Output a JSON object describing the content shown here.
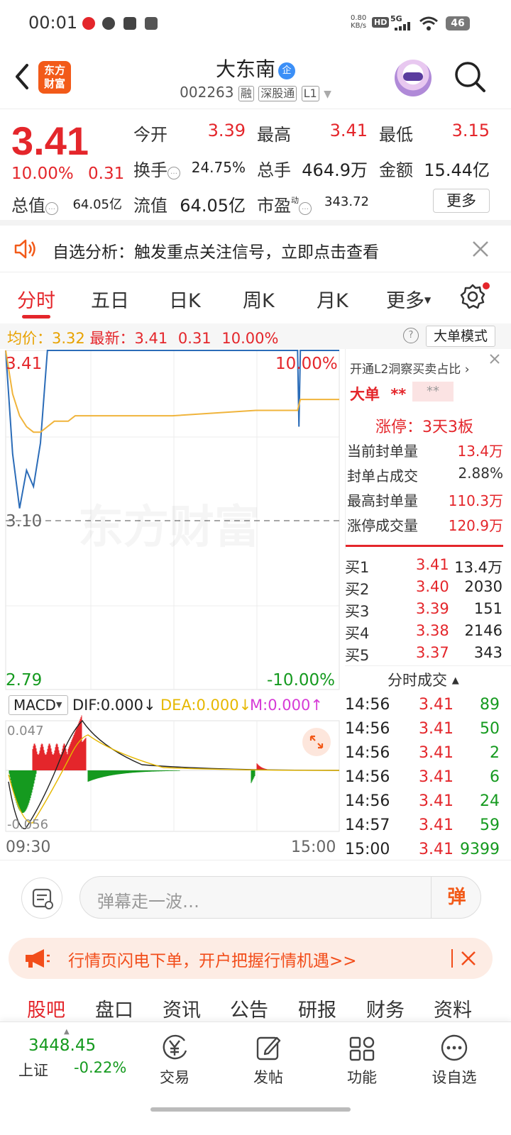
{
  "status_bar": {
    "time": "00:01",
    "net_speed_top": "0.80",
    "net_speed_bottom": "KB/s",
    "hd": "HD",
    "signal": "5G",
    "battery": "46"
  },
  "header": {
    "stock_name": "大东南",
    "qiye_badge": "企",
    "code": "002263",
    "tags": [
      "融",
      "深股通",
      "L1"
    ],
    "logo_line1": "东方",
    "logo_line2": "财富"
  },
  "quote": {
    "price": "3.41",
    "change_pct": "10.00%",
    "change": "0.31",
    "open_label": "今开",
    "open": "3.39",
    "high_label": "最高",
    "high": "3.41",
    "low_label": "最低",
    "low": "3.15",
    "turnover_label": "换手",
    "turnover": "24.75%",
    "volume_label": "总手",
    "volume": "464.9万",
    "amount_label": "金额",
    "amount": "15.44亿",
    "total_cap_label": "总值",
    "total_cap": "64.05亿",
    "float_cap_label": "流值",
    "float_cap": "64.05亿",
    "pe_label": "市盈",
    "pe_sup": "动",
    "pe": "343.72",
    "more_label": "更多"
  },
  "analysis": {
    "text": "自选分析：触发重点关注信号，立即点击查看"
  },
  "tabs": {
    "items": [
      "分时",
      "五日",
      "日K",
      "周K",
      "月K",
      "更多"
    ],
    "active": 0
  },
  "avg_line": {
    "avg_label": "均价：",
    "avg": "3.32",
    "latest_label": "最新：",
    "latest": "3.41",
    "chg": "0.31",
    "pct": "10.00%",
    "big_mode": "大单模式",
    "help": "?"
  },
  "chart": {
    "top_price": "3.41",
    "top_pct": "10.00%",
    "mid_price": "3.10",
    "bottom_price": "2.79",
    "bottom_pct": "-10.00%",
    "watermark": "东方财富",
    "time_start": "09:30",
    "time_end": "15:00",
    "macd_select": "MACD",
    "dif": "DIF:0.000",
    "dea": "DEA:0.000",
    "m": "M:0.000",
    "macd_top": "0.047",
    "macd_bottom": "-0.056",
    "colors": {
      "price": "#2b6cb8",
      "avg": "#f0b43c",
      "up": "#e4262b",
      "down": "#159a1f",
      "dea": "#e6b800",
      "m": "#d63ad6"
    }
  },
  "chart_data": {
    "type": "line",
    "title": "",
    "xlabel": "",
    "ylabel": "",
    "x": [
      "09:30",
      "09:35",
      "09:40",
      "09:45",
      "09:50",
      "09:55",
      "10:00",
      "10:05",
      "10:10",
      "10:15",
      "10:20",
      "11:30",
      "13:00",
      "14:00",
      "14:30",
      "14:31",
      "14:32",
      "15:00"
    ],
    "series": [
      {
        "values": [
          3.41,
          3.22,
          3.12,
          3.19,
          3.16,
          3.24,
          3.41,
          3.41,
          3.41,
          3.41,
          3.41,
          3.41,
          3.41,
          3.41,
          3.41,
          3.27,
          3.41,
          3.41
        ]
      },
      {
        "values": [
          3.41,
          3.33,
          3.29,
          3.27,
          3.26,
          3.26,
          3.27,
          3.28,
          3.28,
          3.28,
          3.29,
          3.29,
          3.29,
          3.3,
          3.3,
          3.31,
          3.32,
          3.32
        ]
      }
    ],
    "ylim": [
      2.79,
      3.41
    ]
  },
  "side": {
    "l2_link": "开通L2洞察买卖占比",
    "big_label": "大单",
    "big_val1": "**",
    "big_val2": "**",
    "limit_label": "涨停：3天3板",
    "rows": [
      {
        "label": "当前封单量",
        "value": "13.4万",
        "color": "red"
      },
      {
        "label": "封单占成交",
        "value": "2.88%",
        "color": "dark"
      },
      {
        "label": "最高封单量",
        "value": "110.3万",
        "color": "red"
      },
      {
        "label": "涨停成交量",
        "value": "120.9万",
        "color": "red"
      }
    ],
    "order_book": [
      {
        "label": "买1",
        "price": "3.41",
        "vol": "13.4万"
      },
      {
        "label": "买2",
        "price": "3.40",
        "vol": "2030"
      },
      {
        "label": "买3",
        "price": "3.39",
        "vol": "151"
      },
      {
        "label": "买4",
        "price": "3.38",
        "vol": "2146"
      },
      {
        "label": "买5",
        "price": "3.37",
        "vol": "343"
      }
    ],
    "ticks_title": "分时成交",
    "ticks": [
      {
        "time": "14:56",
        "price": "3.41",
        "vol": "89",
        "color": "green"
      },
      {
        "time": "14:56",
        "price": "3.41",
        "vol": "50",
        "color": "green"
      },
      {
        "time": "14:56",
        "price": "3.41",
        "vol": "2",
        "color": "green"
      },
      {
        "time": "14:56",
        "price": "3.41",
        "vol": "6",
        "color": "green"
      },
      {
        "time": "14:56",
        "price": "3.41",
        "vol": "24",
        "color": "green"
      },
      {
        "time": "14:57",
        "price": "3.41",
        "vol": "59",
        "color": "green"
      },
      {
        "time": "15:00",
        "price": "3.41",
        "vol": "9399",
        "color": "green"
      }
    ]
  },
  "comment": {
    "placeholder": "弹幕走一波…",
    "dan": "弹"
  },
  "promo": {
    "text": "行情页闪电下单，开户把握行情机遇>>"
  },
  "section_tabs": {
    "items": [
      "股吧",
      "盘口",
      "资讯",
      "公告",
      "研报",
      "财务",
      "资料"
    ],
    "active": 0
  },
  "bottom_nav": {
    "index_value": "3448.45",
    "index_name": "上证",
    "index_change": "-0.22%",
    "items": [
      "交易",
      "发帖",
      "功能",
      "设自选"
    ]
  }
}
